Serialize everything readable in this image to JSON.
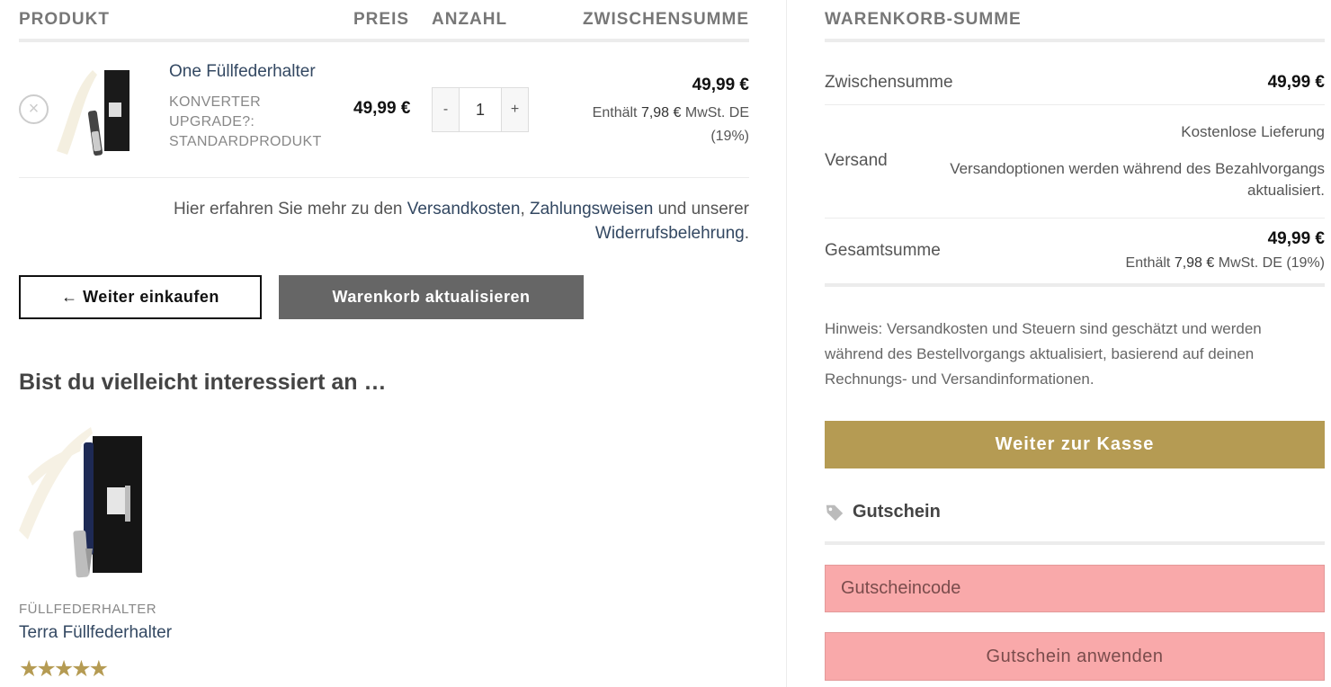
{
  "cart_table": {
    "headers": {
      "product": "Produkt",
      "price": "Preis",
      "quantity": "Anzahl",
      "subtotal": "Zwischensumme"
    },
    "item": {
      "remove_symbol": "×",
      "name": "One Füllfederhalter",
      "meta_line1": "Konverter",
      "meta_line2": "Upgrade?:",
      "meta_line3": "Standardprodukt",
      "price": "49,99 €",
      "qty_minus": "-",
      "qty_value": "1",
      "qty_plus": "+",
      "subtotal": "49,99 €",
      "tax_prefix": "Enthält",
      "tax_amount": "7,98 €",
      "tax_suffix_line1": "MwSt. DE",
      "tax_suffix_line2": "(19%)"
    }
  },
  "legal_note": {
    "prefix": "Hier erfahren Sie mehr zu den",
    "link_shipping": "Versandkosten",
    "comma": ",",
    "link_payment": "Zahlungsweisen",
    "middle": "und unserer",
    "link_withdrawal": "Widerrufsbelehrung",
    "suffix": "."
  },
  "actions": {
    "continue_shopping": "← Weiter einkaufen",
    "update_cart": "Warenkorb aktualisieren"
  },
  "cross_sell": {
    "title": "Bist du vielleicht interessiert an …",
    "product": {
      "category": "Füllfederhalter",
      "name": "Terra Füllfederhalter",
      "stars": "★★★★★",
      "rating": 5
    }
  },
  "totals": {
    "title": "Warenkorb-Summe",
    "subtotal_label": "Zwischensumme",
    "subtotal_value": "49,99 €",
    "shipping_label": "Versand",
    "shipping_method": "Kostenlose Lieferung",
    "shipping_note_line1": "Versandoptionen werden während des Bezahlvorgangs",
    "shipping_note_line2": "aktualisiert.",
    "total_label": "Gesamtsumme",
    "total_value": "49,99 €",
    "total_tax_prefix": "Enthält",
    "total_tax_amount": "7,98 €",
    "total_tax_suffix": "MwSt. DE (19%)"
  },
  "notice": "Hinweis: Versandkosten und Steuern sind geschätzt und werden während des Bestellvorgangs aktualisiert, basierend auf deinen Rechnungs- und Versandinformationen.",
  "checkout_button": "Weiter zur Kasse",
  "coupon": {
    "title": "Gutschein",
    "placeholder": "Gutscheincode",
    "apply_button": "Gutschein anwenden"
  },
  "colors": {
    "accent_gold": "#b59b53",
    "link_navy": "#334862",
    "update_button_gray": "#666666",
    "coupon_highlight": "#f9a9aa"
  },
  "icons": {
    "remove": "close-circle-icon",
    "coupon": "tag-icon"
  }
}
